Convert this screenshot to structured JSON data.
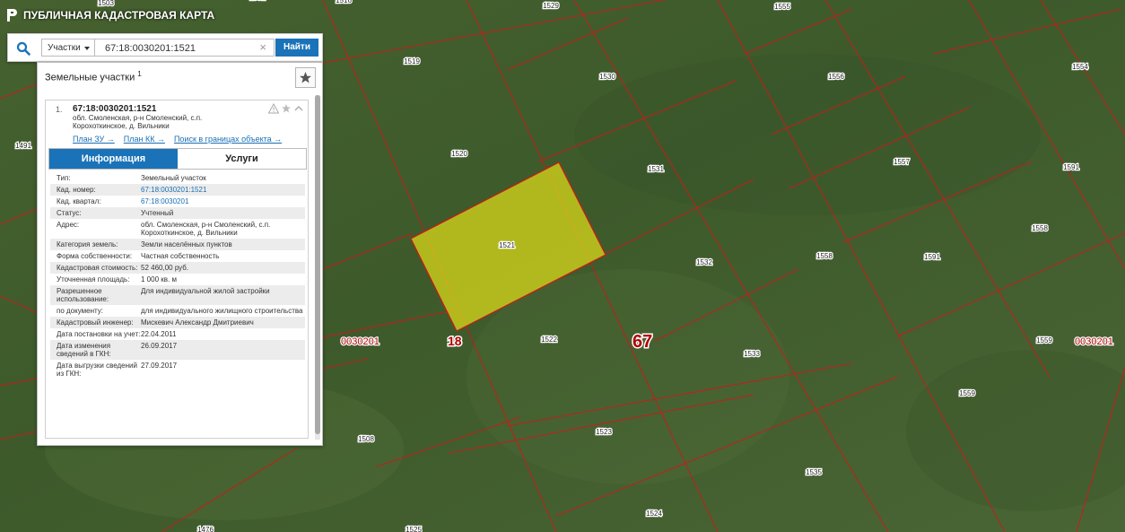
{
  "app": {
    "title": "ПУБЛИЧНАЯ КАДАСТРОВАЯ КАРТА"
  },
  "search": {
    "type_label": "Участки",
    "query": "67:18:0030201:1521",
    "clear_icon": "×",
    "find_label": "Найти"
  },
  "panel": {
    "heading": "Земельные участки",
    "heading_count": "1",
    "result": {
      "index": "1.",
      "cadastral_number": "67:18:0030201:1521",
      "address": "обл. Смоленская, р-н Смоленский, с.п. Корохоткинское, д. Вильники",
      "links": [
        "План ЗУ →",
        "План КК →",
        "Поиск в границах объекта →"
      ]
    },
    "tabs": [
      "Информация",
      "Услуги"
    ],
    "rows": [
      {
        "k": "Тип:",
        "v": "Земельный участок"
      },
      {
        "k": "Кад. номер:",
        "v": "67:18:0030201:1521"
      },
      {
        "k": "Кад. квартал:",
        "v": "67:18:0030201"
      },
      {
        "k": "Статус:",
        "v": "Учтенный"
      },
      {
        "k": "Адрес:",
        "v": "обл. Смоленская, р-н Смоленский, с.п. Корохоткинское, д. Вильники"
      },
      {
        "k": "Категория земель:",
        "v": "Земли населённых пунктов"
      },
      {
        "k": "Форма собственности:",
        "v": "Частная собственность"
      },
      {
        "k": "Кадастровая стоимость:",
        "v": "52 460,00 руб."
      },
      {
        "k": "Уточненная площадь:",
        "v": "1 000 кв. м"
      },
      {
        "k": "Разрешенное использование:",
        "v": "Для индивидуальной жилой застройки"
      },
      {
        "k": "по документу:",
        "v": "для индивидуального жилищного строительства"
      },
      {
        "k": "Кадастровый инженер:",
        "v": "Мискевич Александр Дмитриевич"
      },
      {
        "k": "Дата постановки на учет:",
        "v": "22.04.2011"
      },
      {
        "k": "Дата изменения сведений в ГКН:",
        "v": "26.09.2017"
      },
      {
        "k": "Дата выгрузки сведений из ГКН:",
        "v": "27.09.2017"
      }
    ]
  },
  "map": {
    "parcels": [
      "1503",
      "1516",
      "1591",
      "1529",
      "1555",
      "1554",
      "1519",
      "1530",
      "1556",
      "1491",
      "1520",
      "1531",
      "1557",
      "1591",
      "1521",
      "1532",
      "1558",
      "1558",
      "1591",
      "1522",
      "1533",
      "1559",
      "1559",
      "1508",
      "1523",
      "1535",
      "1524",
      "1476",
      "1525"
    ],
    "region_label": "67",
    "district_label": "18",
    "quarter_labels": [
      "0030201",
      "0030201"
    ]
  },
  "colors": {
    "accent": "#1a73b8",
    "boundary": "#d01818",
    "selected_fill": "#d8d81a"
  }
}
